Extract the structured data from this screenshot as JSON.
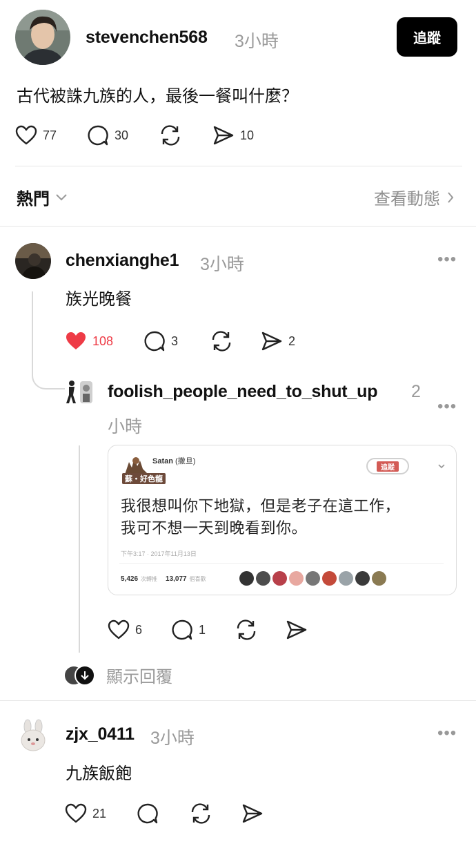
{
  "post": {
    "username": "stevenchen568",
    "time": "3小時",
    "follow_label": "追蹤",
    "text": "古代被誅九族的人，最後一餐叫什麼？",
    "likes": "77",
    "comments": "30",
    "shares": "10"
  },
  "filter": {
    "sort_label": "熱門",
    "activity_label": "查看動態"
  },
  "replies": [
    {
      "username": "chenxianghe1",
      "time": "3小時",
      "text": "族光晚餐",
      "likes": "108",
      "comments": "3",
      "shares": "2",
      "liked": true
    },
    {
      "username": "foolish_people_need_to_shut_up",
      "time_num": "2",
      "time_unit": "小時",
      "likes": "6",
      "comments": "1",
      "embed": {
        "name": "Satan",
        "name_suffix": "(撒旦)",
        "badge": "蘇・好色龍",
        "follow": "追蹤",
        "line1": "我很想叫你下地獄，但是老子在這工作，",
        "line2": "我可不想一天到晚看到你。",
        "date": "下午3:17 · 2017年11月13日",
        "retweets_num": "5,426",
        "retweets_label": "次轉推",
        "likes_num": "13,077",
        "likes_label": "個喜歡"
      }
    },
    {
      "username": "zjx_0411",
      "time": "3小時",
      "text": "九族飯飽",
      "likes": "21"
    }
  ],
  "show_replies_label": "顯示回覆",
  "colors": {
    "like_red": "#ee3b46",
    "muted": "#9a9a9a",
    "follow_bg": "#000000"
  }
}
